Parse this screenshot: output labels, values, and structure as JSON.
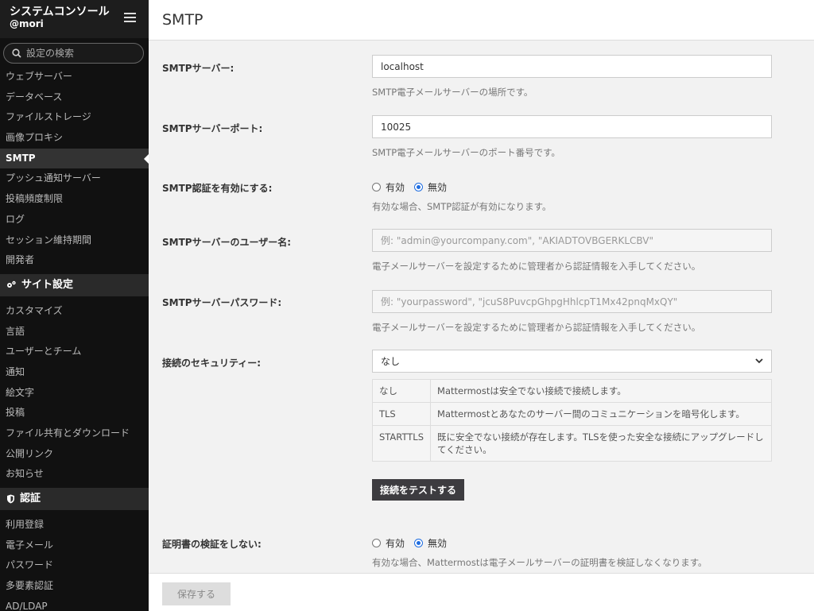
{
  "sidebar": {
    "title": "システムコンソール",
    "user": "@mori",
    "search_placeholder": "設定の検索",
    "items_top": [
      "ウェブサーバー",
      "データベース",
      "ファイルストレージ",
      "画像プロキシ",
      "SMTP",
      "プッシュ通知サーバー",
      "投稿頻度制限",
      "ログ",
      "セッション維持期間",
      "開発者"
    ],
    "active_item": "SMTP",
    "section_site": "サイト設定",
    "items_site": [
      "カスタマイズ",
      "言語",
      "ユーザーとチーム",
      "通知",
      "絵文字",
      "投稿",
      "ファイル共有とダウンロード",
      "公開リンク",
      "お知らせ"
    ],
    "section_auth": "認証",
    "items_auth": [
      "利用登録",
      "電子メール",
      "パスワード",
      "多要素認証",
      "AD/LDAP"
    ]
  },
  "header": {
    "title": "SMTP"
  },
  "form": {
    "smtp_server": {
      "label": "SMTPサーバー:",
      "value": "localhost",
      "help": "SMTP電子メールサーバーの場所です。"
    },
    "smtp_port": {
      "label": "SMTPサーバーポート:",
      "value": "10025",
      "help": "SMTP電子メールサーバーのポート番号です。"
    },
    "smtp_auth": {
      "label": "SMTP認証を有効にする:",
      "opt_true": "有効",
      "opt_false": "無効",
      "selected": "false",
      "help": "有効な場合、SMTP認証が有効になります。"
    },
    "smtp_username": {
      "label": "SMTPサーバーのユーザー名:",
      "placeholder": "例: \"admin@yourcompany.com\", \"AKIADTOVBGERKLCBV\"",
      "help": "電子メールサーバーを設定するために管理者から認証情報を入手してください。"
    },
    "smtp_password": {
      "label": "SMTPサーバーパスワード:",
      "placeholder": "例: \"yourpassword\", \"jcuS8PuvcpGhpgHhlcpT1Mx42pnqMxQY\"",
      "help": "電子メールサーバーを設定するために管理者から認証情報を入手してください。"
    },
    "security": {
      "label": "接続のセキュリティー:",
      "value": "なし",
      "table": [
        {
          "key": "なし",
          "desc": "Mattermostは安全でない接続で接続します。"
        },
        {
          "key": "TLS",
          "desc": "Mattermostとあなたのサーバー間のコミュニケーションを暗号化します。"
        },
        {
          "key": "STARTTLS",
          "desc": "既に安全でない接続が存在します。TLSを使った安全な接続にアップグレードしてください。"
        }
      ],
      "test_button": "接続をテストする"
    },
    "skip_cert": {
      "label": "証明書の検証をしない:",
      "opt_true": "有効",
      "opt_false": "無効",
      "selected": "false",
      "help": "有効な場合、Mattermostは電子メールサーバーの証明書を検証しなくなります。"
    }
  },
  "footer": {
    "save_label": "保存する"
  },
  "colors": {
    "accent": "#1f6de0",
    "sidebar_bg": "#111111"
  }
}
